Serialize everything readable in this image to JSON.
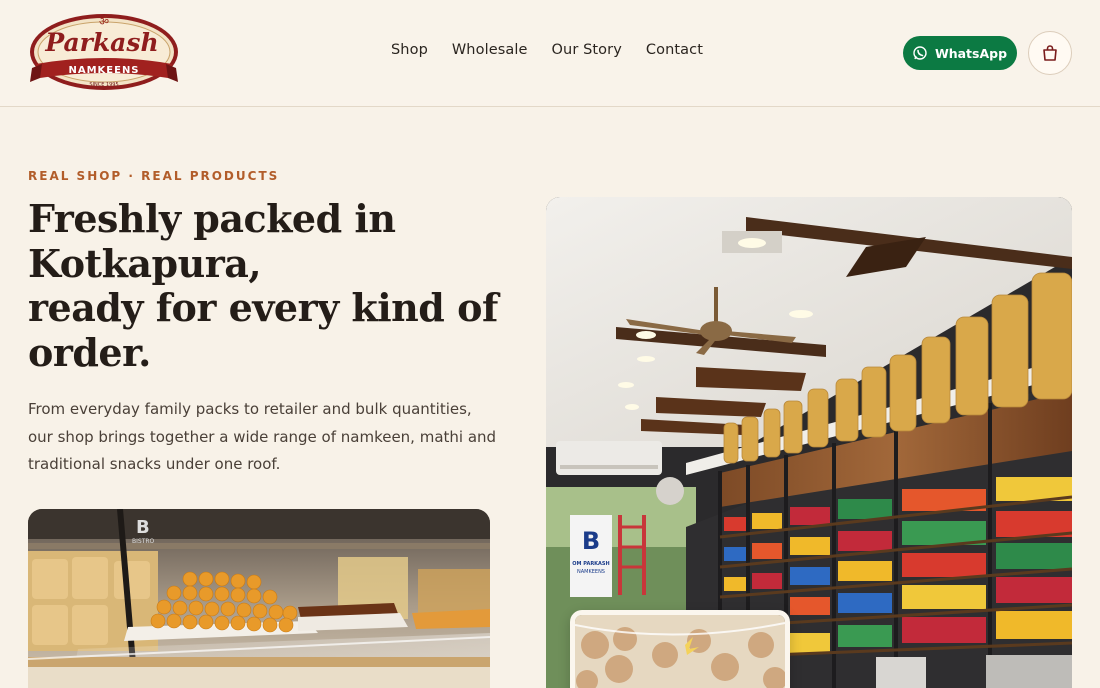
{
  "brand": {
    "name": "Parkash",
    "subtitle": "NAMKEENS",
    "since": "SINCE 1995",
    "om_symbol": "ॐ"
  },
  "nav": {
    "items": [
      {
        "label": "Shop"
      },
      {
        "label": "Wholesale"
      },
      {
        "label": "Our Story"
      },
      {
        "label": "Contact"
      }
    ]
  },
  "actions": {
    "whatsapp_label": "WhatsApp",
    "whatsapp_icon": "whatsapp-icon",
    "cart_icon": "shopping-bag-icon"
  },
  "hero": {
    "eyebrow": "REAL SHOP · REAL PRODUCTS",
    "headline_line1": "Freshly packed in",
    "headline_line2": "Kotkapura,",
    "headline_line3": "ready for every kind of",
    "headline_line4": "order.",
    "lede": "From everyday family packs to retailer and bulk quantities, our shop brings together a wide range of namkeen, mathi and traditional snacks under one roof."
  },
  "photos": {
    "counter_sign": "BISTRO",
    "store_sign_line1": "OM PARKASH",
    "store_sign_line2": "NAMKEENS"
  },
  "colors": {
    "background": "#f8f2e8",
    "accent": "#b25d2a",
    "whatsapp_green": "#0c7a43",
    "text_dark": "#241d18"
  }
}
